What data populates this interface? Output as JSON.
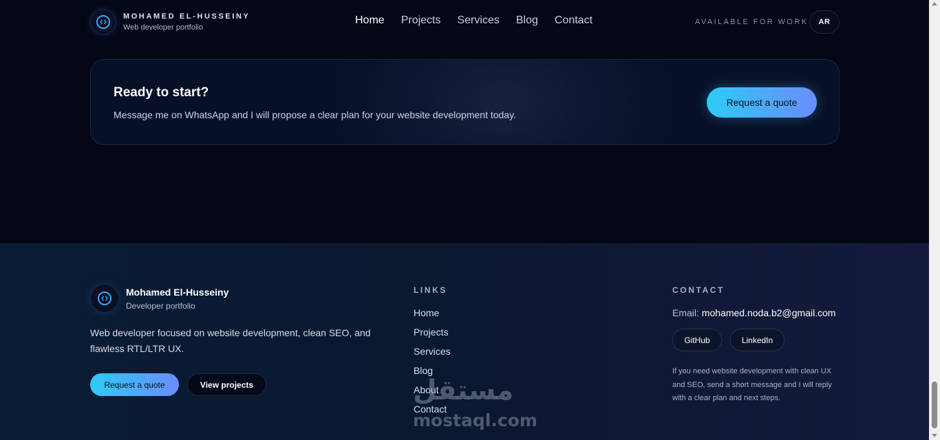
{
  "header": {
    "brand_title": "MOHAMED EL-HUSSEINY",
    "brand_subtitle": "Web developer portfolio",
    "logo_icon": "code-icon",
    "nav": [
      "Home",
      "Projects",
      "Services",
      "Blog",
      "Contact"
    ],
    "active_nav": "Home",
    "availability": "AVAILABLE FOR WORK",
    "language_toggle": "AR"
  },
  "cta": {
    "title": "Ready to start?",
    "text": "Message me on WhatsApp and I will propose a clear plan for your website development today.",
    "button": "Request a quote"
  },
  "footer": {
    "brand_title": "Mohamed El-Husseiny",
    "brand_subtitle": "Developer portfolio",
    "description": "Web developer focused on website development, clean SEO, and flawless RTL/LTR UX.",
    "primary_button": "Request a quote",
    "secondary_button": "View projects",
    "links_heading": "LINKS",
    "links": [
      "Home",
      "Projects",
      "Services",
      "Blog",
      "About",
      "Contact"
    ],
    "contact_heading": "CONTACT",
    "email_label": "Email:",
    "email": "mohamed.noda.b2@gmail.com",
    "social": [
      "GitHub",
      "LinkedIn"
    ],
    "note": "If you need website development with clean UX and SEO, send a short message and I will reply with a clear plan and next steps."
  },
  "watermark": {
    "arabic": "مستقل",
    "latin": "mostaql.com"
  },
  "colors": {
    "background": "#030716",
    "accent_start": "#2dcbf6",
    "accent_end": "#6b8cfb",
    "logo_accent": "#3aa5ff"
  }
}
